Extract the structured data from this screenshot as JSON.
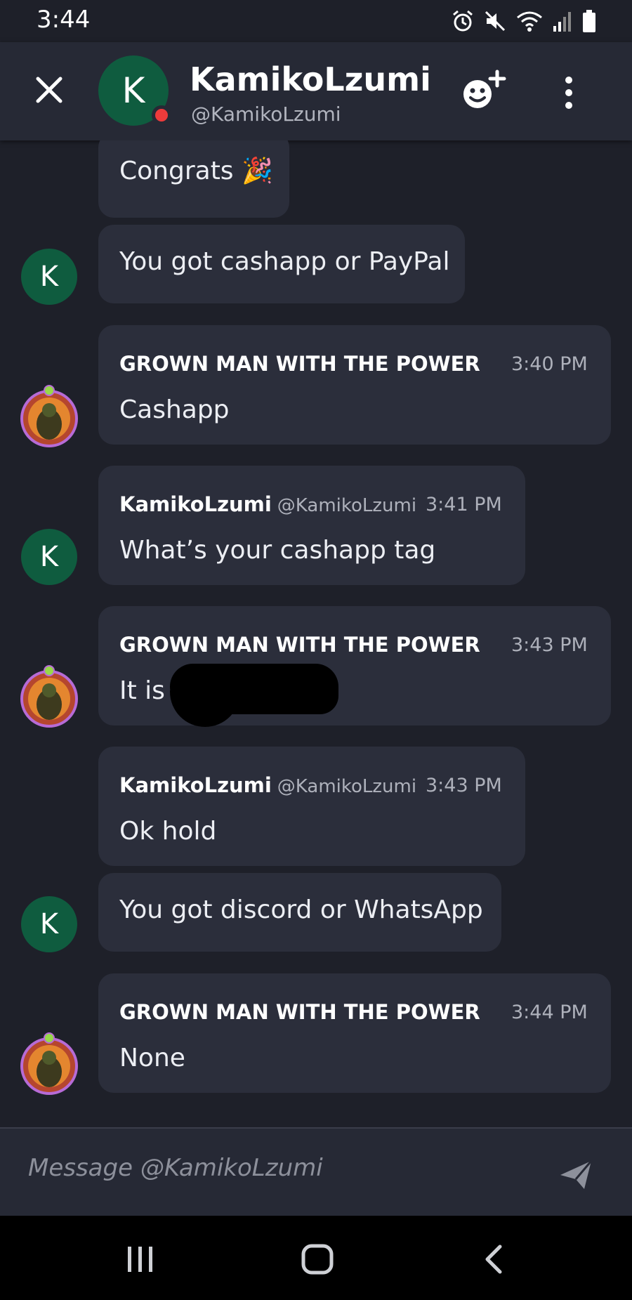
{
  "status_bar": {
    "time": "3:44"
  },
  "header": {
    "avatar_letter": "K",
    "name": "KamikoLzumi",
    "handle": "@KamikoLzumi",
    "presence_color": "#ed3b3b"
  },
  "messages": [
    {
      "text": "Congrats 🎉"
    },
    {
      "avatar": "K",
      "text": "You got cashapp or PayPal"
    },
    {
      "author": "GROWN MAN WITH THE POWER",
      "time": "3:40 PM",
      "text": "Cashapp"
    },
    {
      "avatar": "K",
      "author": "KamikoLzumi",
      "handle": "@KamikoLzumi",
      "time": "3:41 PM",
      "text": "What’s your cashapp tag"
    },
    {
      "author": "GROWN MAN WITH THE POWER",
      "time": "3:43 PM",
      "text": "It is"
    },
    {
      "author": "KamikoLzumi",
      "handle": "@KamikoLzumi",
      "time": "3:43 PM",
      "text": "Ok hold"
    },
    {
      "avatar": "K",
      "text": "You got discord or WhatsApp"
    },
    {
      "author": "GROWN MAN WITH THE POWER",
      "time": "3:44 PM",
      "text": "None"
    }
  ],
  "composer": {
    "placeholder": "Message @KamikoLzumi"
  },
  "colors": {
    "background": "#1e2029",
    "bubble": "#2b2e3b",
    "avatar_green": "#0f5c3f"
  }
}
